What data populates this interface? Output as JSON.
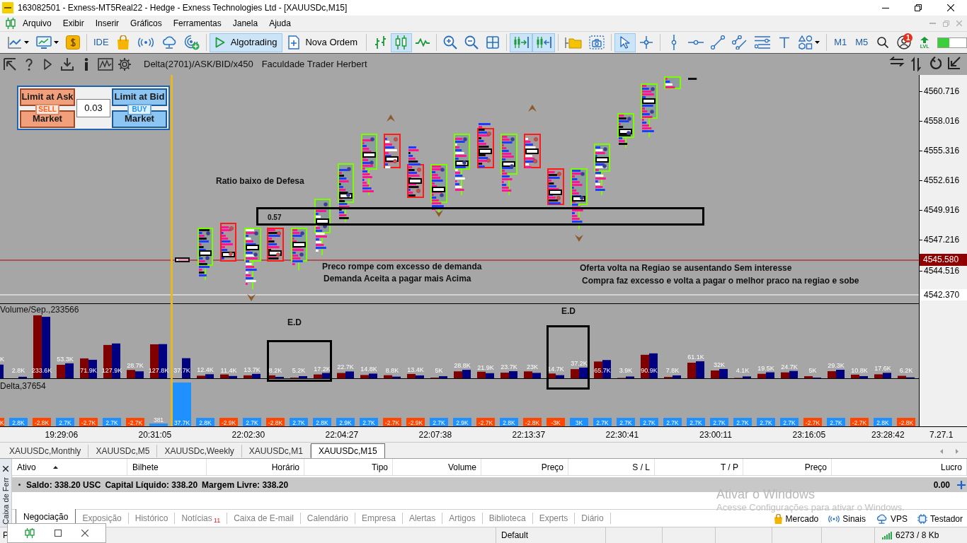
{
  "window": {
    "title": "163082501 - Exness-MT5Real22 - Hedge - Exness Technologies Ltd - [XAUUSDc,M15]"
  },
  "menu": [
    "Arquivo",
    "Exibir",
    "Inserir",
    "Gráficos",
    "Ferramentas",
    "Janela",
    "Ajuda"
  ],
  "toolbar": [
    [
      {
        "kind": "icon",
        "pressed": false
      },
      {
        "kind": "icon",
        "pressed": false
      },
      {
        "kind": "icon",
        "pressed": false
      }
    ],
    [
      {
        "kind": "text",
        "label": "IDE",
        "pressed": false
      },
      {
        "kind": "icon",
        "pressed": false
      },
      {
        "kind": "icon",
        "pressed": false
      },
      {
        "kind": "icon",
        "pressed": false
      },
      {
        "kind": "icon",
        "pressed": false
      }
    ],
    [
      {
        "kind": "labeled",
        "label": "Algotrading",
        "pressed": true
      },
      {
        "kind": "labeled",
        "label": "Nova Ordem",
        "pressed": false
      }
    ],
    [
      {
        "kind": "icon",
        "pressed": false
      },
      {
        "kind": "icon",
        "pressed": true
      },
      {
        "kind": "icon",
        "pressed": false
      }
    ],
    [
      {
        "kind": "icon",
        "pressed": false
      },
      {
        "kind": "icon",
        "pressed": false
      },
      {
        "kind": "icon",
        "pressed": false
      }
    ],
    [
      {
        "kind": "icon",
        "pressed": true
      },
      {
        "kind": "icon",
        "pressed": true
      }
    ],
    [
      {
        "kind": "icon",
        "pressed": false
      },
      {
        "kind": "icon",
        "pressed": false
      }
    ],
    [
      {
        "kind": "icon",
        "pressed": true
      },
      {
        "kind": "icon",
        "pressed": false
      }
    ],
    [
      {
        "kind": "icon",
        "pressed": false
      },
      {
        "kind": "icon",
        "pressed": false
      },
      {
        "kind": "icon",
        "pressed": false
      },
      {
        "kind": "icon",
        "pressed": false
      },
      {
        "kind": "icon",
        "pressed": false
      },
      {
        "kind": "icon",
        "pressed": false
      },
      {
        "kind": "icon",
        "pressed": false
      }
    ],
    [
      {
        "kind": "text",
        "label": "M1",
        "pressed": false
      },
      {
        "kind": "text",
        "label": "M5",
        "pressed": false
      },
      {
        "kind": "icon",
        "pressed": false
      },
      {
        "kind": "icon",
        "pressed": false,
        "badge": "1"
      },
      {
        "kind": "stacked",
        "label": "LVL",
        "pressed": false
      },
      {
        "kind": "meter",
        "level": 0.4
      }
    ]
  ],
  "chart": {
    "indicator": "Delta(2701)/ASK/BID/x450",
    "caption": "Faculdade Trader Herbert",
    "trade_panel": {
      "sell": {
        "limit": "Limit at Ask",
        "action": "SELL",
        "market": "Market"
      },
      "volume": "0.03",
      "buy": {
        "limit": "Limit at Bid",
        "action": "BUY",
        "market": "Market"
      }
    },
    "price_axis": [
      {
        "kind": "tick",
        "label": "4560.716"
      },
      {
        "kind": "tick",
        "label": "4558.016"
      },
      {
        "kind": "tick",
        "label": "4555.316"
      },
      {
        "kind": "tick",
        "label": "4552.616"
      },
      {
        "kind": "tick",
        "label": "4549.916"
      },
      {
        "kind": "tick",
        "label": "4547.216"
      },
      {
        "kind": "current",
        "label": "4545.580"
      },
      {
        "kind": "tick",
        "label": "4544.516"
      },
      {
        "kind": "level",
        "label": "4542.370"
      }
    ],
    "notes": [
      "Ratio baixo de Defesa",
      "0.57",
      "Preco rompe com excesso de demanda",
      "Demanda Aceita a pagar mais Acima",
      "Oferta volta na Regiao se ausentando Sem interesse",
      "Compra faz excesso e volta a pagar o melhor praco na regiao e sobe"
    ],
    "volume_pane": {
      "title": "Volume/Sep.,233566",
      "bar_labels": [
        "K",
        "2.8K",
        "233.6K",
        "53.3K",
        "71.9K",
        "127.9K",
        "28.7K",
        "127.8K",
        "37.7K",
        "12.4K",
        "11.4K",
        "13.7K",
        "8.2K",
        "5.2K",
        "17.2K",
        "22.7K",
        "14.8K",
        "8.8K",
        "13.4K",
        "5K",
        "28.8K",
        "21.9K",
        "23.7K",
        "23K",
        "14.7K",
        "37.2K",
        "65.7K",
        "3.9K",
        "90.9K",
        "7.8K",
        "61.1K",
        "32K",
        "4.1K",
        "19.5K",
        "24.7K",
        "5K",
        "29.3K",
        "10.8K",
        "17.6K",
        "6.2K"
      ],
      "notes": [
        "E.D",
        "E.D"
      ]
    },
    "delta_pane": {
      "title": "Delta,37654",
      "bars": [
        {
          "label": "K",
          "color": "#ff4500"
        },
        {
          "label": "2.8K",
          "color": "#1e90ff"
        },
        {
          "label": "-2.8K",
          "color": "#ff4500"
        },
        {
          "label": "2.7K",
          "color": "#1e90ff"
        },
        {
          "label": "-2.7K",
          "color": "#ff4500"
        },
        {
          "label": "2.7K",
          "color": "#1e90ff"
        },
        {
          "label": "-2.7K",
          "color": "#ff4500"
        },
        {
          "label": "381",
          "color": "#1e90ff"
        },
        {
          "label": "37.7K",
          "color": "#1e90ff"
        },
        {
          "label": "2.8K",
          "color": "#1e90ff"
        },
        {
          "label": "-2.9K",
          "color": "#ff4500"
        },
        {
          "label": "2.7K",
          "color": "#1e90ff"
        },
        {
          "label": "-2.8K",
          "color": "#ff4500"
        },
        {
          "label": "2.7K",
          "color": "#1e90ff"
        },
        {
          "label": "2.8K",
          "color": "#1e90ff"
        },
        {
          "label": "2.9K",
          "color": "#1e90ff"
        },
        {
          "label": "2.7K",
          "color": "#1e90ff"
        },
        {
          "label": "-2.7K",
          "color": "#ff4500"
        },
        {
          "label": "-2.9K",
          "color": "#ff4500"
        },
        {
          "label": "2.7K",
          "color": "#1e90ff"
        },
        {
          "label": "2.9K",
          "color": "#1e90ff"
        },
        {
          "label": "-2.7K",
          "color": "#ff4500"
        },
        {
          "label": "2.8K",
          "color": "#1e90ff"
        },
        {
          "label": "-2.8K",
          "color": "#ff4500"
        },
        {
          "label": "-3K",
          "color": "#ff4500"
        },
        {
          "label": "3K",
          "color": "#1e90ff"
        },
        {
          "label": "2.7K",
          "color": "#1e90ff"
        },
        {
          "label": "2.7K",
          "color": "#1e90ff"
        },
        {
          "label": "2.7K",
          "color": "#1e90ff"
        },
        {
          "label": "2.7K",
          "color": "#1e90ff"
        },
        {
          "label": "2.7K",
          "color": "#1e90ff"
        },
        {
          "label": "2.7K",
          "color": "#1e90ff"
        },
        {
          "label": "2.7K",
          "color": "#1e90ff"
        },
        {
          "label": "2.7K",
          "color": "#1e90ff"
        },
        {
          "label": "2.7K",
          "color": "#1e90ff"
        },
        {
          "label": "-2.7K",
          "color": "#ff4500"
        },
        {
          "label": "2.7K",
          "color": "#1e90ff"
        },
        {
          "label": "-2.7K",
          "color": "#ff4500"
        },
        {
          "label": "2.8K",
          "color": "#1e90ff"
        },
        {
          "label": "-2.8K",
          "color": "#ff4500"
        }
      ]
    },
    "time_axis": [
      "19:29:06",
      "20:31:05",
      "22:02:30",
      "22:04:27",
      "22:07:38",
      "22:13:37",
      "22:30:41",
      "23:00:11",
      "23:16:05",
      "23:28:42"
    ],
    "corner_label": "7.27.1"
  },
  "chart_tabs": [
    {
      "label": "XAUUSDc,Monthly",
      "selected": false
    },
    {
      "label": "XAUUSDc,M5",
      "selected": false
    },
    {
      "label": "XAUUSDc,Weekly",
      "selected": false
    },
    {
      "label": "XAUUSDc,M1",
      "selected": false
    },
    {
      "label": "XAUUSDc,M15",
      "selected": true
    }
  ],
  "toolbox": {
    "title": "Caixa de Ferr",
    "columns": [
      {
        "label": "Ativo",
        "sorted": true
      },
      {
        "label": "Bilhete",
        "sorted": false
      },
      {
        "label": "Horário",
        "sorted": false
      },
      {
        "label": "Tipo",
        "sorted": false
      },
      {
        "label": "Volume",
        "sorted": false
      },
      {
        "label": "Preço",
        "sorted": false
      },
      {
        "label": "S / L",
        "sorted": false
      },
      {
        "label": "T / P",
        "sorted": false
      },
      {
        "label": "Preço",
        "sorted": false
      },
      {
        "label": "Lucro",
        "sorted": false
      }
    ],
    "balance": [
      "Saldo: 338.20 USC",
      "Capital Líquido: 338.20",
      "Margem Livre: 338.20"
    ],
    "profit": "0.00",
    "tabs": [
      {
        "label": "Negociação",
        "selected": true
      },
      {
        "label": "Exposição",
        "selected": false
      },
      {
        "label": "Histórico",
        "selected": false
      },
      {
        "label": "Notícias",
        "selected": false,
        "badge": "11"
      },
      {
        "label": "Caixa de E-mail",
        "selected": false
      },
      {
        "label": "Calendário",
        "selected": false
      },
      {
        "label": "Empresa",
        "selected": false
      },
      {
        "label": "Alertas",
        "selected": false
      },
      {
        "label": "Artigos",
        "selected": false
      },
      {
        "label": "Biblioteca",
        "selected": false
      },
      {
        "label": "Experts",
        "selected": false
      },
      {
        "label": "Diário",
        "selected": false
      }
    ],
    "services": [
      "Mercado",
      "Sinais",
      "VPS",
      "Testador"
    ]
  },
  "status_bar": {
    "left": "P",
    "profile": "Default",
    "traffic": "6273 / 8 Kb"
  },
  "activation_notice": {
    "title": "Ativar o Windows",
    "text": "Acesse Configurações para ativar o Windows."
  }
}
